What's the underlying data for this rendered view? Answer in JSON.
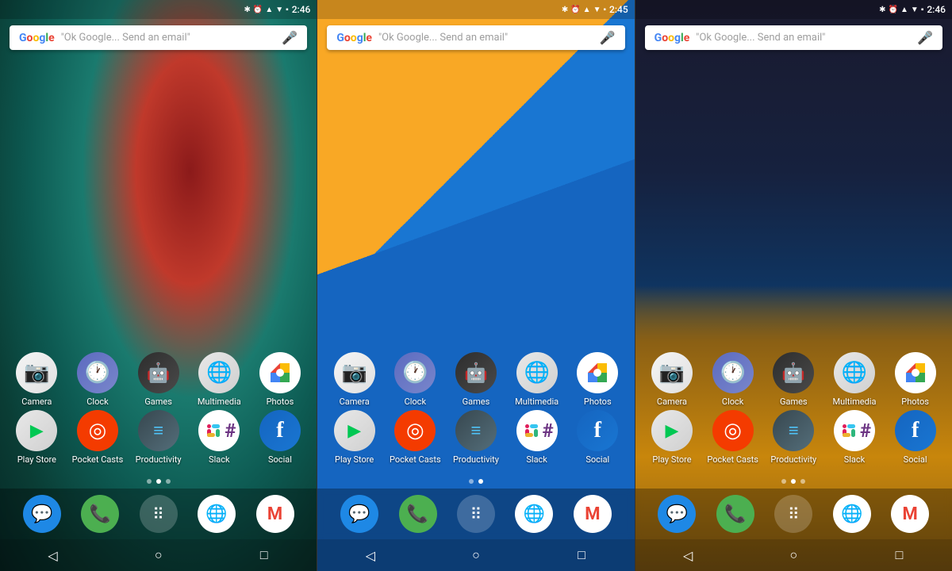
{
  "phones": [
    {
      "id": "phone1",
      "wallpaper": "ocean-aerial",
      "statusBar": {
        "time": "2:46",
        "icons": [
          "bluetooth",
          "alarm",
          "signal",
          "wifi",
          "battery"
        ]
      },
      "searchBar": {
        "googleLogo": "Google",
        "placeholder": "\"Ok Google... Send an email\"",
        "micLabel": "mic"
      },
      "appRows": [
        {
          "apps": [
            {
              "icon": "camera",
              "label": "Camera"
            },
            {
              "icon": "clock",
              "label": "Clock"
            },
            {
              "icon": "games",
              "label": "Games"
            },
            {
              "icon": "multimedia",
              "label": "Multimedia"
            },
            {
              "icon": "photos",
              "label": "Photos"
            }
          ]
        },
        {
          "apps": [
            {
              "icon": "playstore",
              "label": "Play Store"
            },
            {
              "icon": "pocketcasts",
              "label": "Pocket Casts"
            },
            {
              "icon": "productivity",
              "label": "Productivity"
            },
            {
              "icon": "slack",
              "label": "Slack"
            },
            {
              "icon": "social",
              "label": "Social"
            }
          ]
        }
      ],
      "pageDots": [
        false,
        true,
        false
      ],
      "dock": [
        "messages",
        "phone",
        "apps",
        "chrome",
        "gmail"
      ],
      "navBar": [
        "back",
        "home",
        "recents"
      ]
    },
    {
      "id": "phone2",
      "wallpaper": "material-design",
      "statusBar": {
        "time": "2:45",
        "icons": [
          "bluetooth",
          "alarm",
          "signal",
          "wifi",
          "battery"
        ]
      },
      "searchBar": {
        "googleLogo": "Google",
        "placeholder": "\"Ok Google... Send an email\"",
        "micLabel": "mic"
      },
      "appRows": [
        {
          "apps": [
            {
              "icon": "camera",
              "label": "Camera"
            },
            {
              "icon": "clock",
              "label": "Clock"
            },
            {
              "icon": "games",
              "label": "Games"
            },
            {
              "icon": "multimedia",
              "label": "Multimedia"
            },
            {
              "icon": "photos",
              "label": "Photos"
            }
          ]
        },
        {
          "apps": [
            {
              "icon": "playstore",
              "label": "Play Store"
            },
            {
              "icon": "pocketcasts",
              "label": "Pocket Casts"
            },
            {
              "icon": "productivity",
              "label": "Productivity"
            },
            {
              "icon": "slack",
              "label": "Slack"
            },
            {
              "icon": "social",
              "label": "Social"
            }
          ]
        }
      ],
      "pageDots": [
        false,
        true
      ],
      "dock": [
        "messages",
        "phone",
        "apps",
        "chrome",
        "gmail"
      ],
      "navBar": [
        "back",
        "home",
        "recents"
      ]
    },
    {
      "id": "phone3",
      "wallpaper": "pyramid",
      "statusBar": {
        "time": "2:46",
        "icons": [
          "bluetooth",
          "alarm",
          "signal",
          "wifi",
          "battery"
        ]
      },
      "searchBar": {
        "googleLogo": "Google",
        "placeholder": "\"Ok Google... Send an email\"",
        "micLabel": "mic"
      },
      "appRows": [
        {
          "apps": [
            {
              "icon": "camera",
              "label": "Camera"
            },
            {
              "icon": "clock",
              "label": "Clock"
            },
            {
              "icon": "games",
              "label": "Games"
            },
            {
              "icon": "multimedia",
              "label": "Multimedia"
            },
            {
              "icon": "photos",
              "label": "Photos"
            }
          ]
        },
        {
          "apps": [
            {
              "icon": "playstore",
              "label": "Play Store"
            },
            {
              "icon": "pocketcasts",
              "label": "Pocket Casts"
            },
            {
              "icon": "productivity",
              "label": "Productivity"
            },
            {
              "icon": "slack",
              "label": "Slack"
            },
            {
              "icon": "social",
              "label": "Social"
            }
          ]
        }
      ],
      "pageDots": [
        false,
        true,
        false
      ],
      "dock": [
        "messages",
        "phone",
        "apps",
        "chrome",
        "gmail"
      ],
      "navBar": [
        "back",
        "home",
        "recents"
      ]
    }
  ],
  "labels": {
    "camera": "Camera",
    "clock": "Clock",
    "games": "Games",
    "multimedia": "Multimedia",
    "photos": "Photos",
    "playstore": "Play Store",
    "pocketcasts": "Pocket Casts",
    "productivity": "Productivity",
    "slack": "Slack",
    "social": "Social"
  }
}
